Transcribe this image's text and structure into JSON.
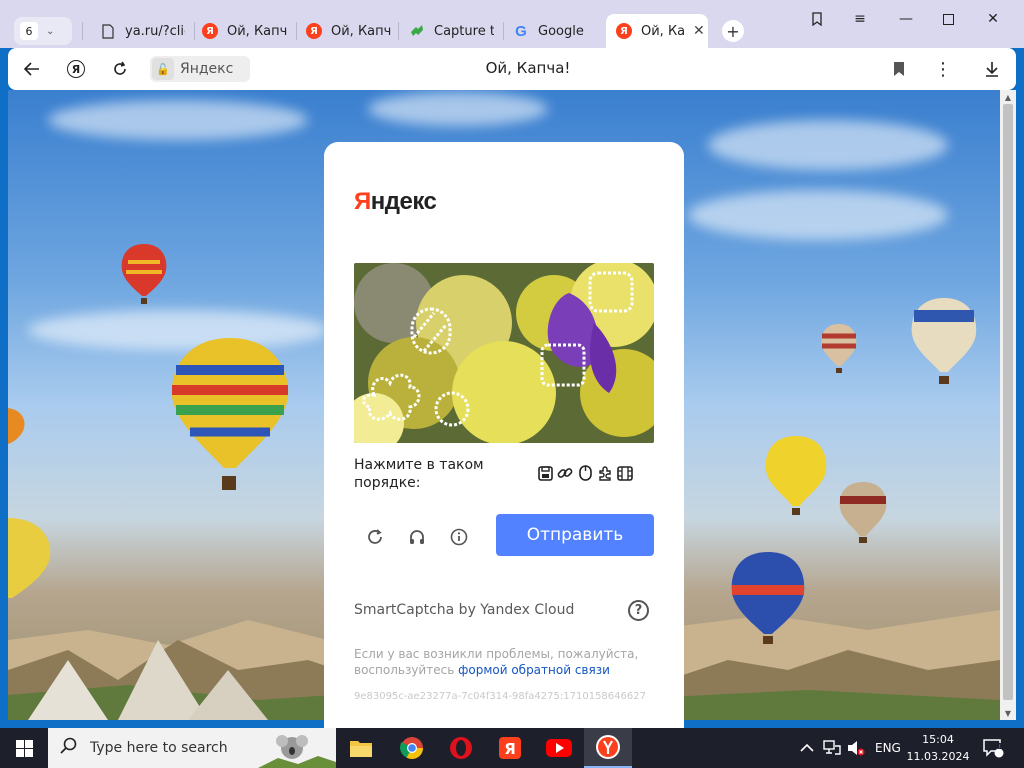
{
  "browser": {
    "tab_count": "6",
    "tabs": [
      {
        "label": "ya.ru/?clic",
        "icon": "page-icon",
        "active": false
      },
      {
        "label": "Ой, Капча",
        "icon": "yandex-icon",
        "active": false
      },
      {
        "label": "Ой, Капча",
        "icon": "yandex-icon",
        "active": false
      },
      {
        "label": "Capture th",
        "icon": "capture-icon",
        "active": false
      },
      {
        "label": "Google",
        "icon": "google-icon",
        "active": false
      },
      {
        "label": "Ой, Кап",
        "icon": "yandex-icon",
        "active": true
      }
    ],
    "site_chip": "Яндекс",
    "page_title": "Ой, Капча!"
  },
  "captcha": {
    "brand_first": "Я",
    "brand_rest": "ндекс",
    "instruction": "Нажмите в таком порядке:",
    "sequence_icons": [
      "save-icon",
      "link-icon",
      "mouse-icon",
      "puzzle-icon",
      "film-icon"
    ],
    "submit_label": "Отправить",
    "provider": "SmartCaptcha by Yandex Cloud",
    "help_symbol": "?",
    "note_text": "Если у вас возникли проблемы, пожалуйста, воспользуйтесь ",
    "note_link": "формой обратной связи",
    "hash": "9e83095c-ae23277a-7c04f314-98fa4275:1710158646627"
  },
  "taskbar": {
    "search_placeholder": "Type here to search",
    "language": "ENG",
    "time": "15:04",
    "date": "11.03.2024",
    "notification_count": "1"
  },
  "colors": {
    "yandex_red": "#fc3f1d",
    "submit_blue": "#5282ff",
    "link_blue": "#1556c2",
    "taskbar": "#1d1f2b",
    "tabbar": "#d9d8ee"
  }
}
